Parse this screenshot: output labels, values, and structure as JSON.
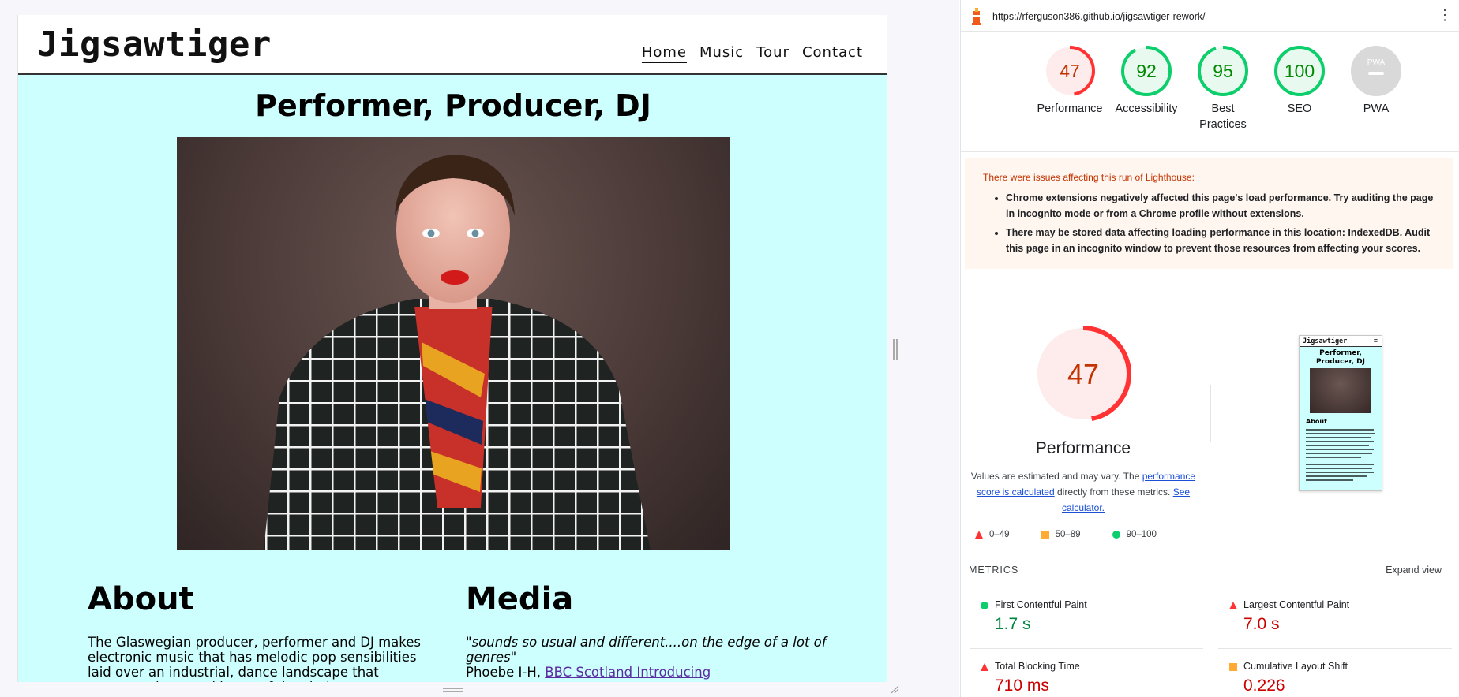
{
  "site": {
    "logo": "Jigsawtiger",
    "nav": [
      {
        "label": "Home",
        "active": true
      },
      {
        "label": "Music",
        "active": false
      },
      {
        "label": "Tour",
        "active": false
      },
      {
        "label": "Contact",
        "active": false
      }
    ],
    "hero_title": "Performer, Producer, DJ",
    "about_heading": "About",
    "about_text": "The Glaswegian producer, performer and DJ makes electronic music that has melodic pop sensibilities laid over an industrial, dance landscape that connects the sound beats of the city's",
    "media_heading": "Media",
    "media_quote": "\"sounds so usual and different....on the edge of a lot of genres\"",
    "media_credit_prefix": "Phoebe I-H, ",
    "media_credit_link": "BBC Scotland Introducing",
    "colors": {
      "background": "#ccfffe",
      "link": "#5a2ca0"
    }
  },
  "lighthouse": {
    "url": "https://rferguson386.github.io/jigsawtiger-rework/",
    "scores": [
      {
        "name": "Performance",
        "label": "Performance",
        "score": 47,
        "color": "#ff3333",
        "bg": "#fdeceb",
        "text": "#c33300"
      },
      {
        "name": "Accessibility",
        "label": "Accessibility",
        "score": 92,
        "color": "#0cce6b",
        "bg": "#e8f9ef",
        "text": "#008800"
      },
      {
        "name": "Best Practices",
        "label": "Best\nPractices",
        "score": 95,
        "color": "#0cce6b",
        "bg": "#e8f9ef",
        "text": "#008800"
      },
      {
        "name": "SEO",
        "label": "SEO",
        "score": 100,
        "color": "#0cce6b",
        "bg": "#e8f9ef",
        "text": "#008800"
      }
    ],
    "pwa": {
      "label": "PWA",
      "badge": "PWA"
    },
    "warning_title": "There were issues affecting this run of Lighthouse:",
    "warnings": [
      "Chrome extensions negatively affected this page's load performance. Try auditing the page in incognito mode or from a Chrome profile without extensions.",
      "There may be stored data affecting loading performance in this location: IndexedDB. Audit this page in an incognito window to prevent those resources from affecting your scores."
    ],
    "big_score": 47,
    "big_label": "Performance",
    "desc_prefix": "Values are estimated and may vary. The ",
    "desc_link1": "performance score is calculated",
    "desc_middle": " directly from these metrics. ",
    "desc_link2": "See calculator.",
    "legend": [
      {
        "range": "0–49",
        "shape": "triangle",
        "color": "#ff3333"
      },
      {
        "range": "50–89",
        "shape": "square",
        "color": "#ffaa33"
      },
      {
        "range": "90–100",
        "shape": "circle",
        "color": "#0cce6b"
      }
    ],
    "thumbnail": {
      "logo": "Jigsawtiger",
      "title": "Performer,\nProducer, DJ",
      "about": "About"
    },
    "metrics_label": "METRICS",
    "expand_label": "Expand view",
    "metrics": [
      {
        "name": "First Contentful Paint",
        "value": "1.7 s",
        "status": "pass",
        "color": "#018642"
      },
      {
        "name": "Largest Contentful Paint",
        "value": "7.0 s",
        "status": "fail",
        "color": "#cc0000"
      },
      {
        "name": "Total Blocking Time",
        "value": "710 ms",
        "status": "fail",
        "color": "#cc0000"
      },
      {
        "name": "Cumulative Layout Shift",
        "value": "0.226",
        "status": "average",
        "color": "#cc0000"
      }
    ]
  }
}
